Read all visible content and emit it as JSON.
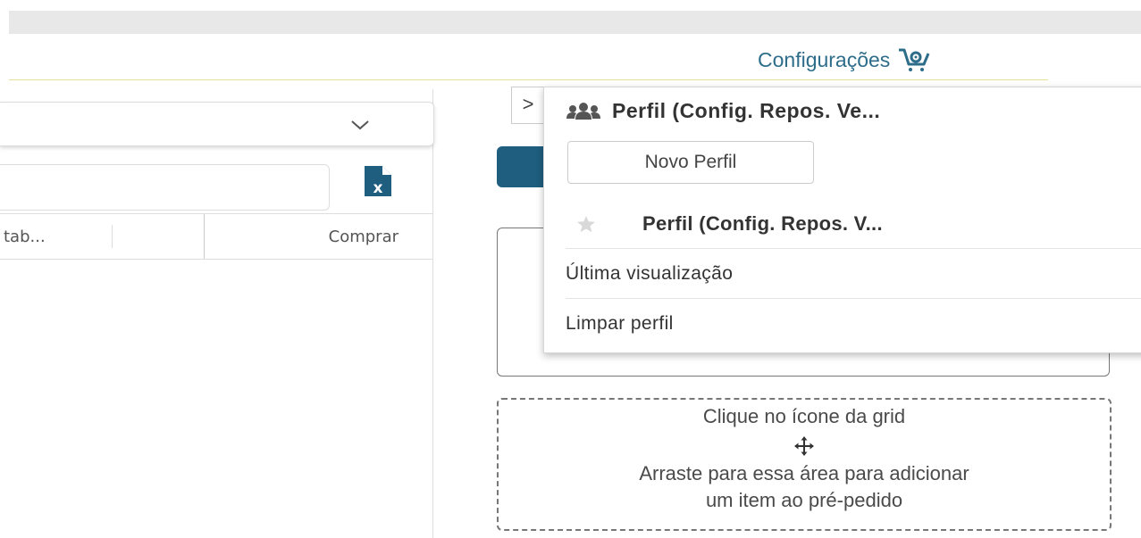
{
  "header": {
    "config_label": "Configurações",
    "config_icon": "basket-settings-icon"
  },
  "left_panel": {
    "dropdown_icon": "chevron-down-icon",
    "export_icon": "excel-icon",
    "columns": [
      "tab...",
      "Comprar"
    ]
  },
  "drop_area": {
    "line1": "Clique no ícone da grid",
    "line2": "Arraste para essa área para adicionar",
    "line3": "um item ao pré-pedido",
    "icon": "move-icon"
  },
  "profile_menu": {
    "toggle": ">",
    "title": "Perfil (Config. Repos. Ve...",
    "new_profile": "Novo Perfil",
    "saved_profile": "Perfil (Config. Repos. V...",
    "items": [
      "Última visualização",
      "Limpar perfil"
    ]
  },
  "colors": {
    "accent": "#1f5e7f",
    "link": "#2e6d8a",
    "header_line": "#e9df9a"
  }
}
